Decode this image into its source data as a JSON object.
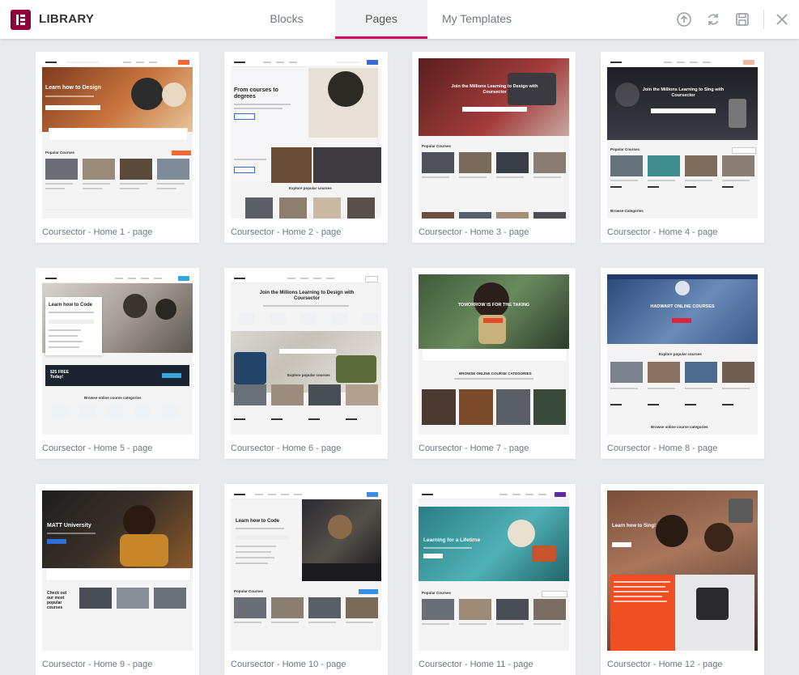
{
  "header": {
    "title": "LIBRARY",
    "tabs": [
      {
        "label": "Blocks",
        "active": false
      },
      {
        "label": "Pages",
        "active": true
      },
      {
        "label": "My Templates",
        "active": false
      }
    ],
    "icons": [
      "upload-icon",
      "sync-icon",
      "save-icon",
      "close-icon"
    ],
    "accent_color": "#d30c5c",
    "logo_color": "#92003b"
  },
  "templates": [
    {
      "title": "Coursector - Home 1 - page",
      "hero_text": "Learn how to Design",
      "theme": "#a4552f"
    },
    {
      "title": "Coursector - Home 2 - page",
      "hero_text": "From courses to degrees",
      "theme": "#f5f5f7"
    },
    {
      "title": "Coursector - Home 3 - page",
      "hero_text": "Join the Millions Learning to Design  with Coursector",
      "theme": "#7a2b2b"
    },
    {
      "title": "Coursector - Home 4 - page",
      "hero_text": "Join the Millions Learning to Sing  with Coursector",
      "theme": "#2d2d33"
    },
    {
      "title": "Coursector - Home 5 - page",
      "hero_text": "Learn how to Code",
      "theme": "#e6e3de"
    },
    {
      "title": "Coursector - Home 6 - page",
      "hero_text": "Join the Millions Learning to Design  with Coursector",
      "theme": "#ffffff"
    },
    {
      "title": "Coursector - Home 7 - page",
      "hero_text": "TOMORROW IS FOR THE TAKING",
      "theme": "#4f6a48"
    },
    {
      "title": "Coursector - Home 8 - page",
      "hero_text": "HADWART ONLINE COURSES",
      "theme": "#1f3a6b"
    },
    {
      "title": "Coursector - Home 9 - page",
      "hero_text": "MATT University",
      "theme": "#2a2a2a"
    },
    {
      "title": "Coursector - Home 10 - page",
      "hero_text": "Learn how to Code",
      "theme": "#1b1b1f"
    },
    {
      "title": "Coursector - Home 11 - page",
      "hero_text": "Learning for a Lifetime",
      "theme": "#2f8f94"
    },
    {
      "title": "Coursector - Home 12 - page",
      "hero_text": "Learn how to Sing!",
      "theme": "#8a5a44"
    }
  ]
}
